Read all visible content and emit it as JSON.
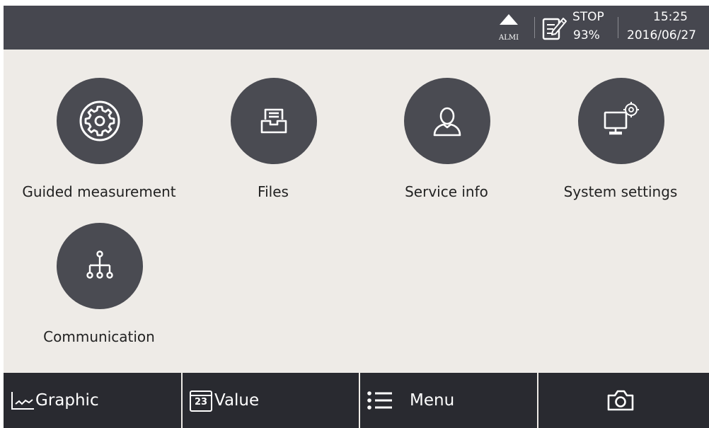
{
  "status_bar": {
    "alarm_label": "ALMI",
    "record_state": "STOP",
    "record_percent": "93%",
    "time": "15:25",
    "date": "2016/06/27"
  },
  "menu": {
    "items": [
      {
        "label": "Guided measurement",
        "icon": "gear-icon"
      },
      {
        "label": "Files",
        "icon": "file-tray-icon"
      },
      {
        "label": "Service info",
        "icon": "user-icon"
      },
      {
        "label": "System settings",
        "icon": "monitor-settings-icon"
      },
      {
        "label": "Communication",
        "icon": "network-tree-icon"
      }
    ]
  },
  "toolbar": {
    "graphic_label": "Graphic",
    "value_label": "Value",
    "value_icon_text": "23",
    "menu_label": "Menu",
    "camera_icon": "camera-icon"
  },
  "colors": {
    "status_bar_bg": "#46474f",
    "background": "#eeebe7",
    "tile_circle": "#4a4b52",
    "toolbar_bg": "#292a30",
    "text": "#222222"
  }
}
